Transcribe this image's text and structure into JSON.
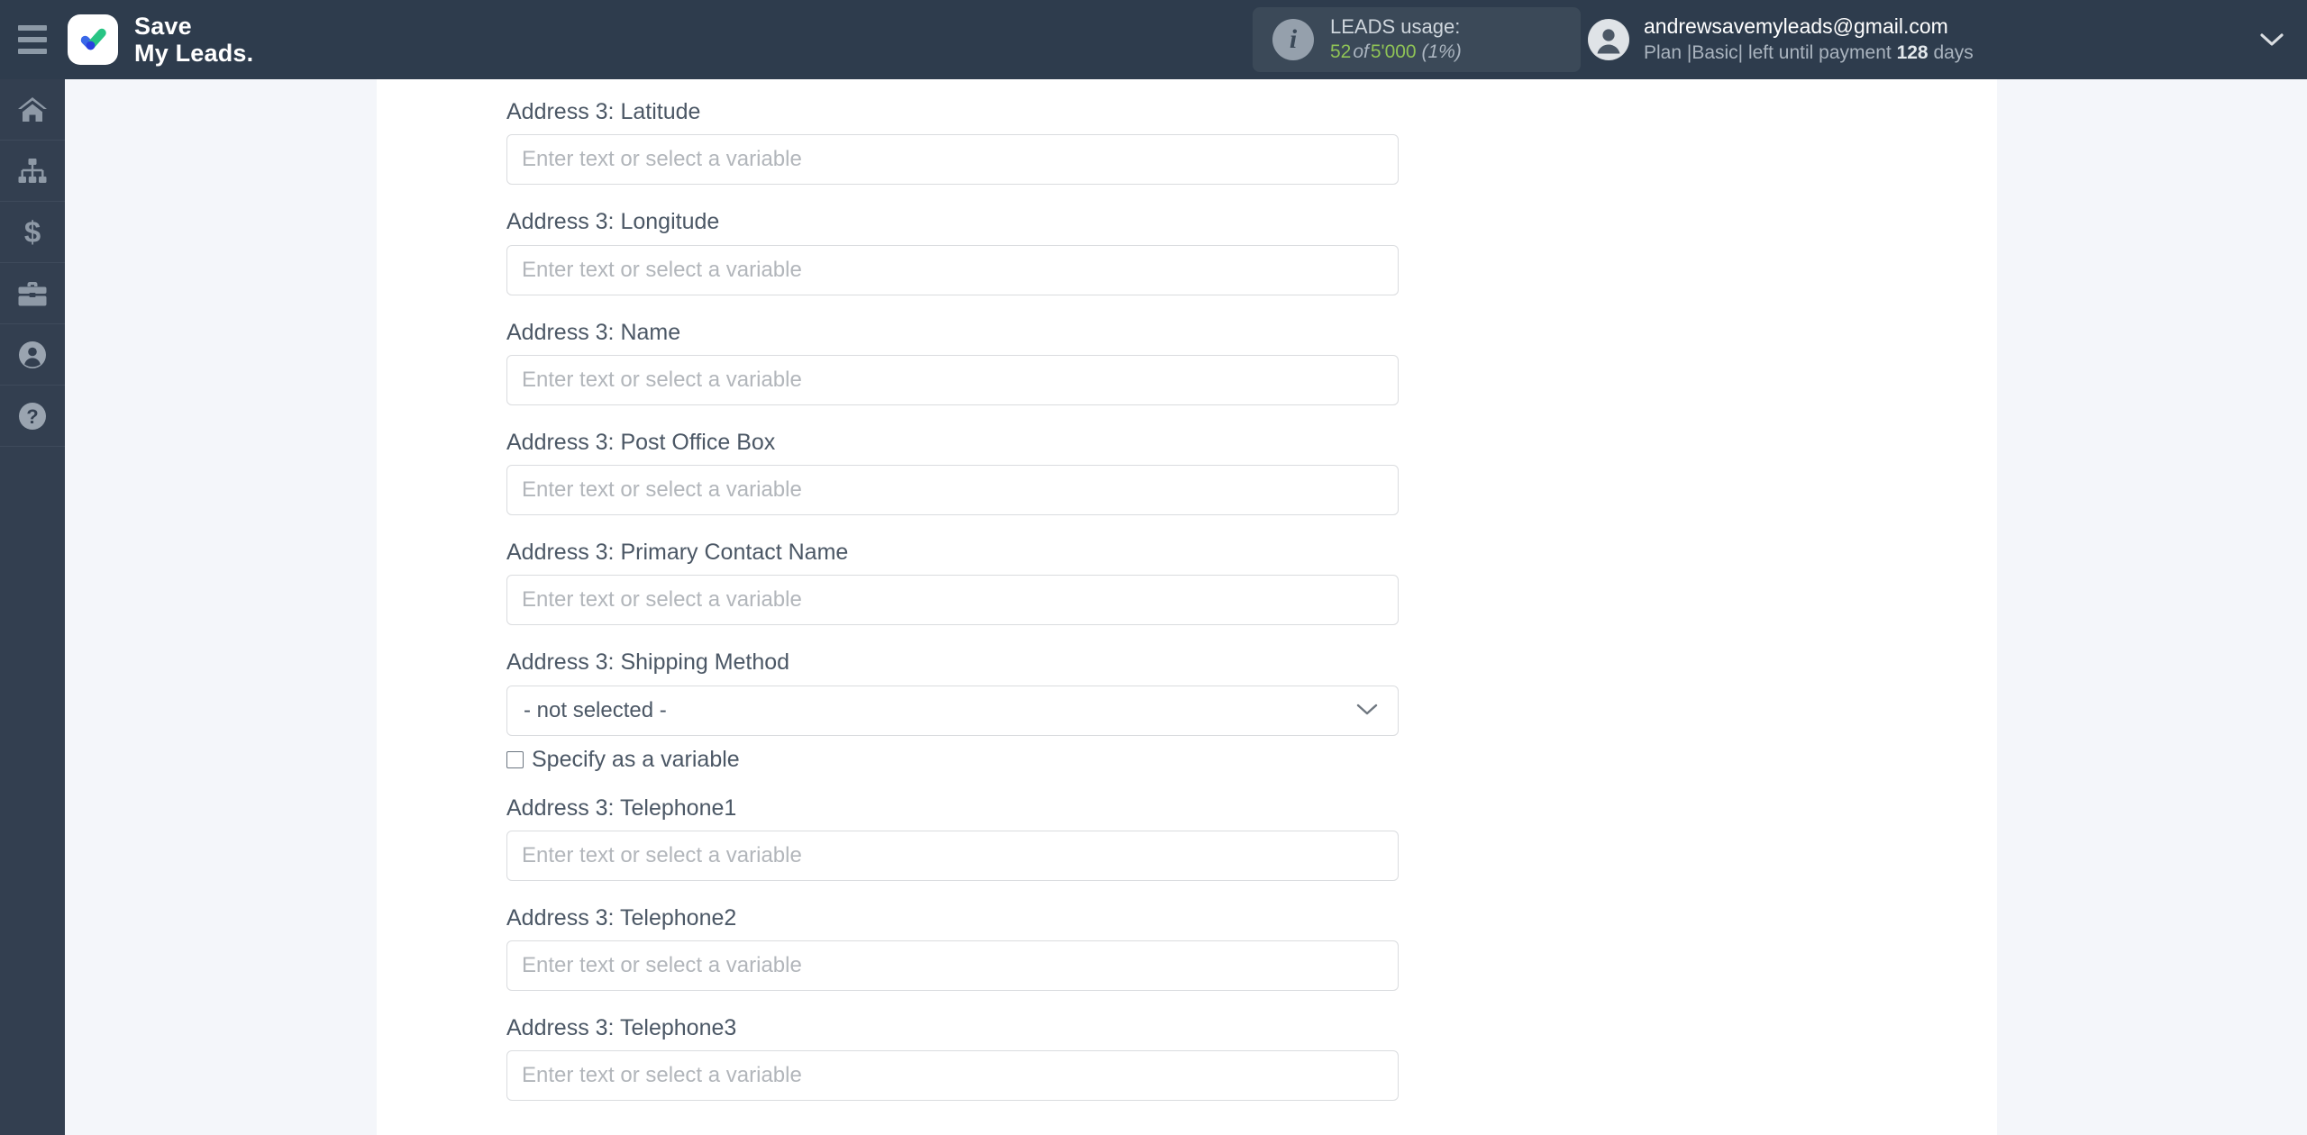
{
  "header": {
    "menu_icon": "hamburger-icon",
    "brand_line1": "Save",
    "brand_line2": "My Leads.",
    "brand_logo_icon": "checkmark-logo-icon",
    "usage": {
      "info_icon": "info-icon",
      "title": "LEADS usage:",
      "used": "52",
      "of": "of",
      "total": "5'000",
      "percent": "(1%)"
    },
    "account": {
      "avatar_icon": "user-avatar-icon",
      "email": "andrewsavemyleads@gmail.com",
      "plan_prefix": "Plan |Basic| left until payment",
      "plan_days": "128",
      "plan_suffix": "days",
      "caret_icon": "chevron-down-icon"
    }
  },
  "sidebar": {
    "items": [
      {
        "name": "home",
        "icon": "home-icon"
      },
      {
        "name": "connections",
        "icon": "sitemap-icon"
      },
      {
        "name": "billing",
        "icon": "dollar-icon"
      },
      {
        "name": "services",
        "icon": "briefcase-icon"
      },
      {
        "name": "profile",
        "icon": "user-icon"
      },
      {
        "name": "help",
        "icon": "question-circle-icon"
      }
    ]
  },
  "form": {
    "input_placeholder": "Enter text or select a variable",
    "checkbox_label": "Specify as a variable",
    "select_caret_icon": "chevron-down-icon",
    "fields": [
      {
        "label": "Address 3: Latitude",
        "type": "text",
        "value": ""
      },
      {
        "label": "Address 3: Longitude",
        "type": "text",
        "value": ""
      },
      {
        "label": "Address 3: Name",
        "type": "text",
        "value": ""
      },
      {
        "label": "Address 3: Post Office Box",
        "type": "text",
        "value": ""
      },
      {
        "label": "Address 3: Primary Contact Name",
        "type": "text",
        "value": ""
      },
      {
        "label": "Address 3: Shipping Method",
        "type": "select",
        "value": "- not selected -"
      },
      {
        "label": "Address 3: Telephone1",
        "type": "text",
        "value": ""
      },
      {
        "label": "Address 3: Telephone2",
        "type": "text",
        "value": ""
      },
      {
        "label": "Address 3: Telephone3",
        "type": "text",
        "value": ""
      }
    ]
  },
  "colors": {
    "topbar": "#2e3c4d",
    "rail": "#333f50",
    "page_bg": "#f4f6fa",
    "panel": "#ffffff",
    "accent_green": "#8fc356",
    "logo_blue": "#3a68e8",
    "logo_green": "#28c584"
  }
}
